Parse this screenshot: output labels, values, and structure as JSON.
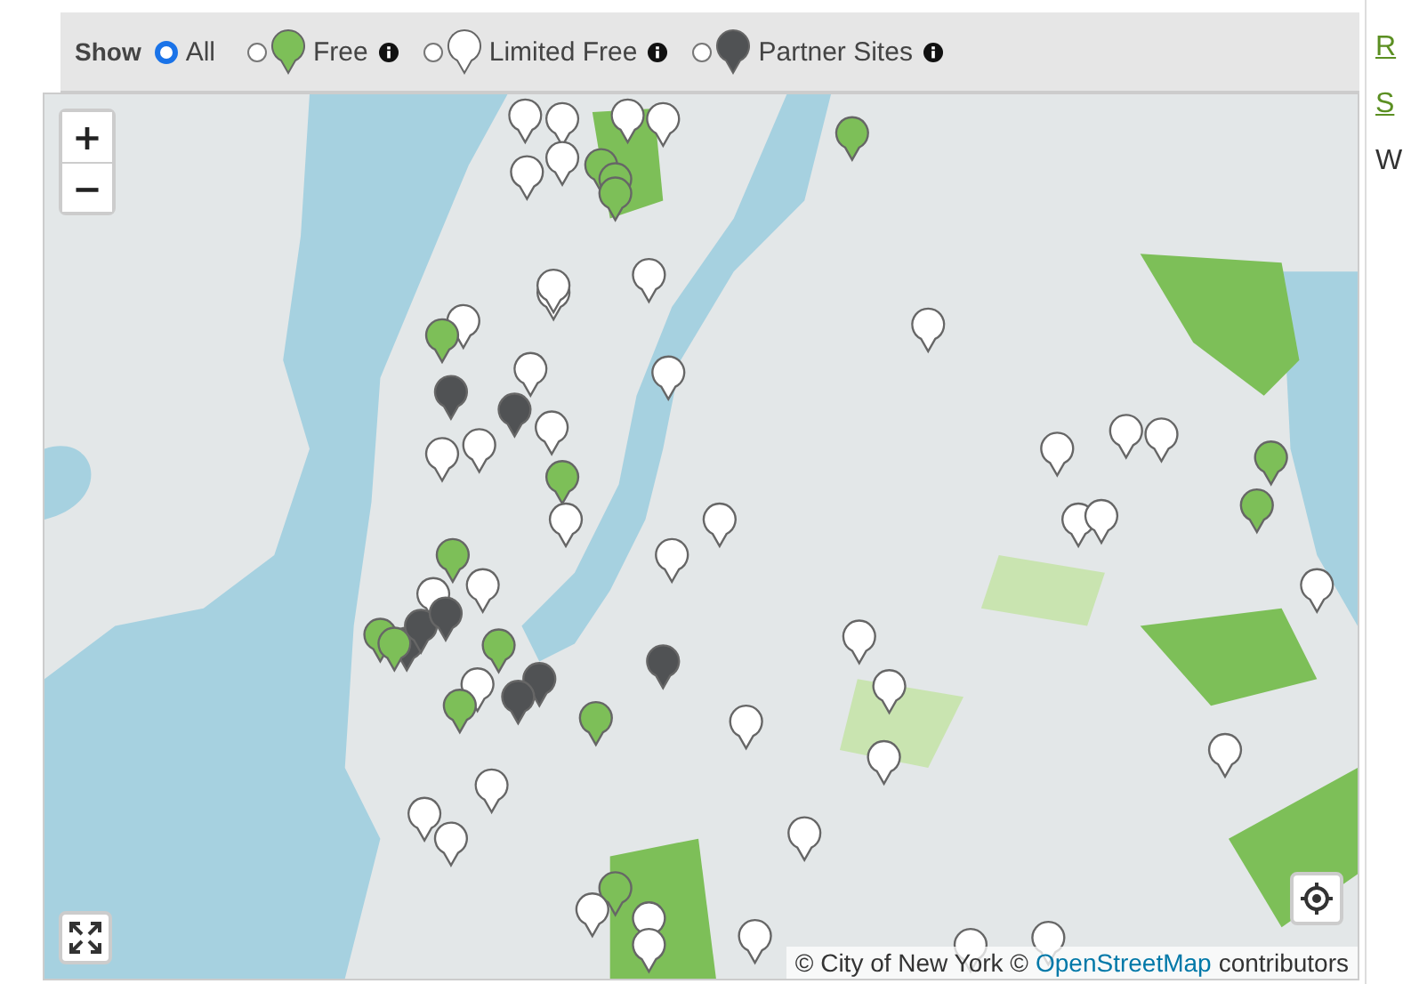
{
  "filter": {
    "label": "Show",
    "options": [
      {
        "label": "All",
        "kind": "all",
        "selected": true,
        "info": false
      },
      {
        "label": "Free",
        "kind": "free",
        "selected": false,
        "info": true
      },
      {
        "label": "Limited Free",
        "kind": "limited",
        "selected": false,
        "info": true
      },
      {
        "label": "Partner Sites",
        "kind": "partner",
        "selected": false,
        "info": true
      }
    ]
  },
  "map": {
    "zoom_in": "+",
    "zoom_out": "−",
    "attribution": {
      "prefix": "© City of New York ©",
      "link": "OpenStreetMap",
      "suffix": "contributors"
    }
  },
  "side_links": [
    {
      "label": "R",
      "kind": "link"
    },
    {
      "label": "S",
      "kind": "link"
    },
    {
      "label": "W",
      "kind": "text"
    }
  ]
}
